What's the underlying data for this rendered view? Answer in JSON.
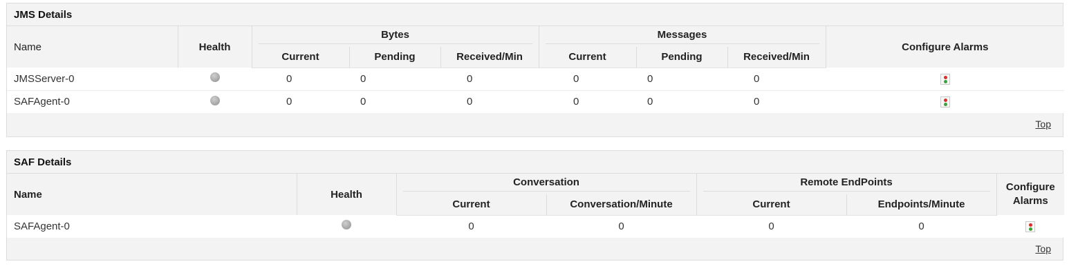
{
  "jms": {
    "title": "JMS Details",
    "headers": {
      "name": "Name",
      "health": "Health",
      "bytes": "Bytes",
      "messages": "Messages",
      "configure": "Configure Alarms",
      "current": "Current",
      "pending": "Pending",
      "received": "Received/Min"
    },
    "rows": [
      {
        "name": "JMSServer-0",
        "bytes_current": "0",
        "bytes_pending": "0",
        "bytes_received": "0",
        "msg_current": "0",
        "msg_pending": "0",
        "msg_received": "0"
      },
      {
        "name": "SAFAgent-0",
        "bytes_current": "0",
        "bytes_pending": "0",
        "bytes_received": "0",
        "msg_current": "0",
        "msg_pending": "0",
        "msg_received": "0"
      }
    ],
    "top_link": "Top"
  },
  "saf": {
    "title": "SAF Details",
    "headers": {
      "name": "Name",
      "health": "Health",
      "conversation": "Conversation",
      "remote": "Remote EndPoints",
      "configure_line1": "Configure",
      "configure_line2": "Alarms",
      "current": "Current",
      "conv_per_min": "Conversation/Minute",
      "remote_current": "Current",
      "endpoints_per_min": "Endpoints/Minute"
    },
    "rows": [
      {
        "name": "SAFAgent-0",
        "conv_current": "0",
        "conv_per_min": "0",
        "remote_current": "0",
        "endpoints_per_min": "0"
      }
    ],
    "top_link": "Top"
  },
  "icons": {
    "health": "gray-status-dot-icon",
    "alarm": "traffic-light-icon"
  },
  "colors": {
    "panel_bg": "#f3f3f3",
    "row_bg": "#ffffff",
    "border": "#dcdcdc",
    "health_dot": "#a0a0a0",
    "alarm_red": "#d9302a",
    "alarm_green": "#3aa13a"
  }
}
